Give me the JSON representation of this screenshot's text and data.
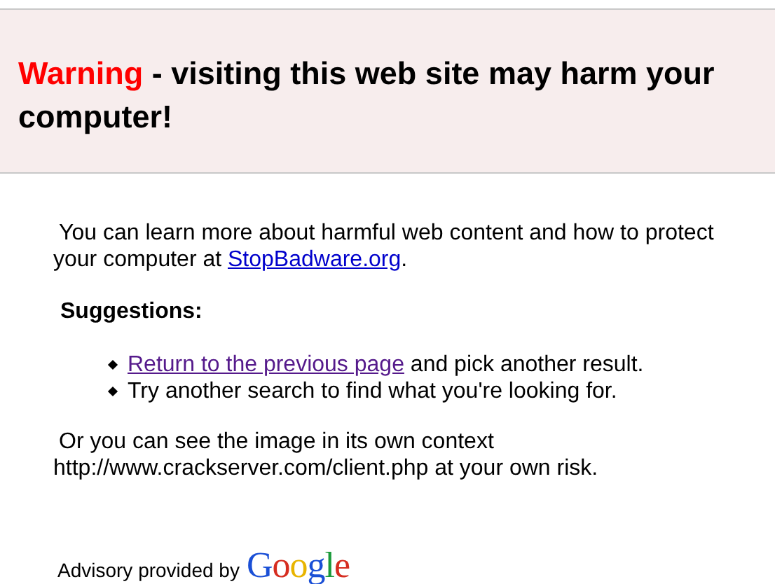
{
  "heading": {
    "warning": "Warning",
    "text": " - visiting this web site may harm your computer!"
  },
  "intro": {
    "text": "You can learn more about harmful web content and how to protect your computer at ",
    "link": "StopBadware.org",
    "after": "."
  },
  "suggestions_title": "Suggestions:",
  "suggestions": [
    {
      "link": "Return to the previous page",
      "text": " and pick another result."
    },
    {
      "text": "Try another search to find what you're looking for."
    }
  ],
  "context": "Or you can see the image in its own context http://www.crackserver.com/client.php at your own risk.",
  "footer": {
    "text": "Advisory provided by",
    "logo": "Google"
  }
}
